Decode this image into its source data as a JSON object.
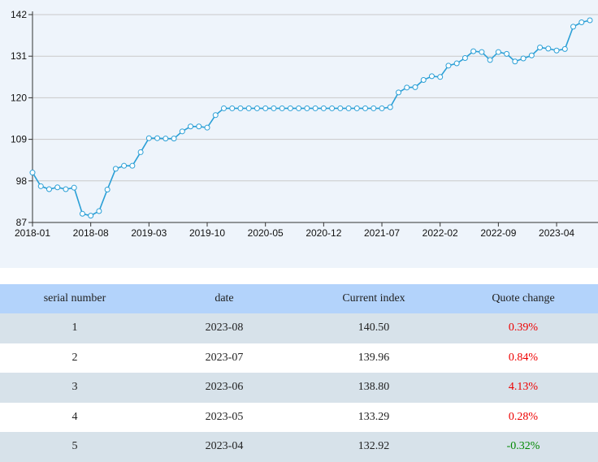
{
  "chart_data": {
    "type": "line",
    "x_ticks": [
      "2018-01",
      "2018-08",
      "2019-03",
      "2019-10",
      "2020-05",
      "2020-12",
      "2021-07",
      "2022-02",
      "2022-09",
      "2023-04"
    ],
    "y_ticks": [
      87,
      98,
      109,
      120,
      131,
      142
    ],
    "ylim": [
      87,
      142
    ],
    "x": [
      "2018-01",
      "2018-02",
      "2018-03",
      "2018-04",
      "2018-05",
      "2018-06",
      "2018-07",
      "2018-08",
      "2018-09",
      "2018-10",
      "2018-11",
      "2018-12",
      "2019-01",
      "2019-02",
      "2019-03",
      "2019-04",
      "2019-05",
      "2019-06",
      "2019-07",
      "2019-08",
      "2019-09",
      "2019-10",
      "2019-11",
      "2019-12",
      "2020-01",
      "2020-02",
      "2020-03",
      "2020-04",
      "2020-05",
      "2020-06",
      "2020-07",
      "2020-08",
      "2020-09",
      "2020-10",
      "2020-11",
      "2020-12",
      "2021-01",
      "2021-02",
      "2021-03",
      "2021-04",
      "2021-05",
      "2021-06",
      "2021-07",
      "2021-08",
      "2021-09",
      "2021-10",
      "2021-11",
      "2021-12",
      "2022-01",
      "2022-02",
      "2022-03",
      "2022-04",
      "2022-05",
      "2022-06",
      "2022-07",
      "2022-08",
      "2022-09",
      "2022-10",
      "2022-11",
      "2022-12",
      "2023-01",
      "2023-02",
      "2023-03",
      "2023-04",
      "2023-05",
      "2023-06",
      "2023-07",
      "2023-08"
    ],
    "values": [
      100.2,
      96.6,
      95.8,
      96.3,
      95.8,
      96.2,
      89.3,
      88.8,
      90.0,
      95.7,
      101.2,
      102.0,
      102.0,
      105.6,
      109.3,
      109.3,
      109.2,
      109.2,
      111.1,
      112.4,
      112.4,
      112.1,
      115.4,
      117.2,
      117.2,
      117.2,
      117.2,
      117.2,
      117.2,
      117.2,
      117.2,
      117.2,
      117.2,
      117.2,
      117.2,
      117.2,
      117.2,
      117.2,
      117.2,
      117.2,
      117.2,
      117.2,
      117.2,
      117.5,
      121.4,
      122.7,
      122.8,
      124.7,
      125.7,
      125.5,
      128.5,
      129.1,
      130.5,
      132.3,
      132.1,
      130.0,
      132.1,
      131.6,
      129.6,
      130.4,
      131.2,
      133.3,
      133.0,
      132.5,
      132.9,
      138.8,
      139.96,
      140.5
    ],
    "line_color": "#2a9fd6",
    "grid": true
  },
  "table": {
    "headers": [
      "serial number",
      "date",
      "Current index",
      "Quote change"
    ],
    "rows": [
      {
        "serial": "1",
        "date": "2023-08",
        "index": "140.50",
        "change": "0.39%",
        "dir": "pos"
      },
      {
        "serial": "2",
        "date": "2023-07",
        "index": "139.96",
        "change": "0.84%",
        "dir": "pos"
      },
      {
        "serial": "3",
        "date": "2023-06",
        "index": "138.80",
        "change": "4.13%",
        "dir": "pos"
      },
      {
        "serial": "4",
        "date": "2023-05",
        "index": "133.29",
        "change": "0.28%",
        "dir": "pos"
      },
      {
        "serial": "5",
        "date": "2023-04",
        "index": "132.92",
        "change": "-0.32%",
        "dir": "neg"
      }
    ]
  },
  "colors": {
    "positive": "#ee0000",
    "negative": "#008800",
    "header_bg": "#b3d3fb",
    "odd_row_bg": "#d7e2ea",
    "panel_bg": "#eef4fb"
  }
}
